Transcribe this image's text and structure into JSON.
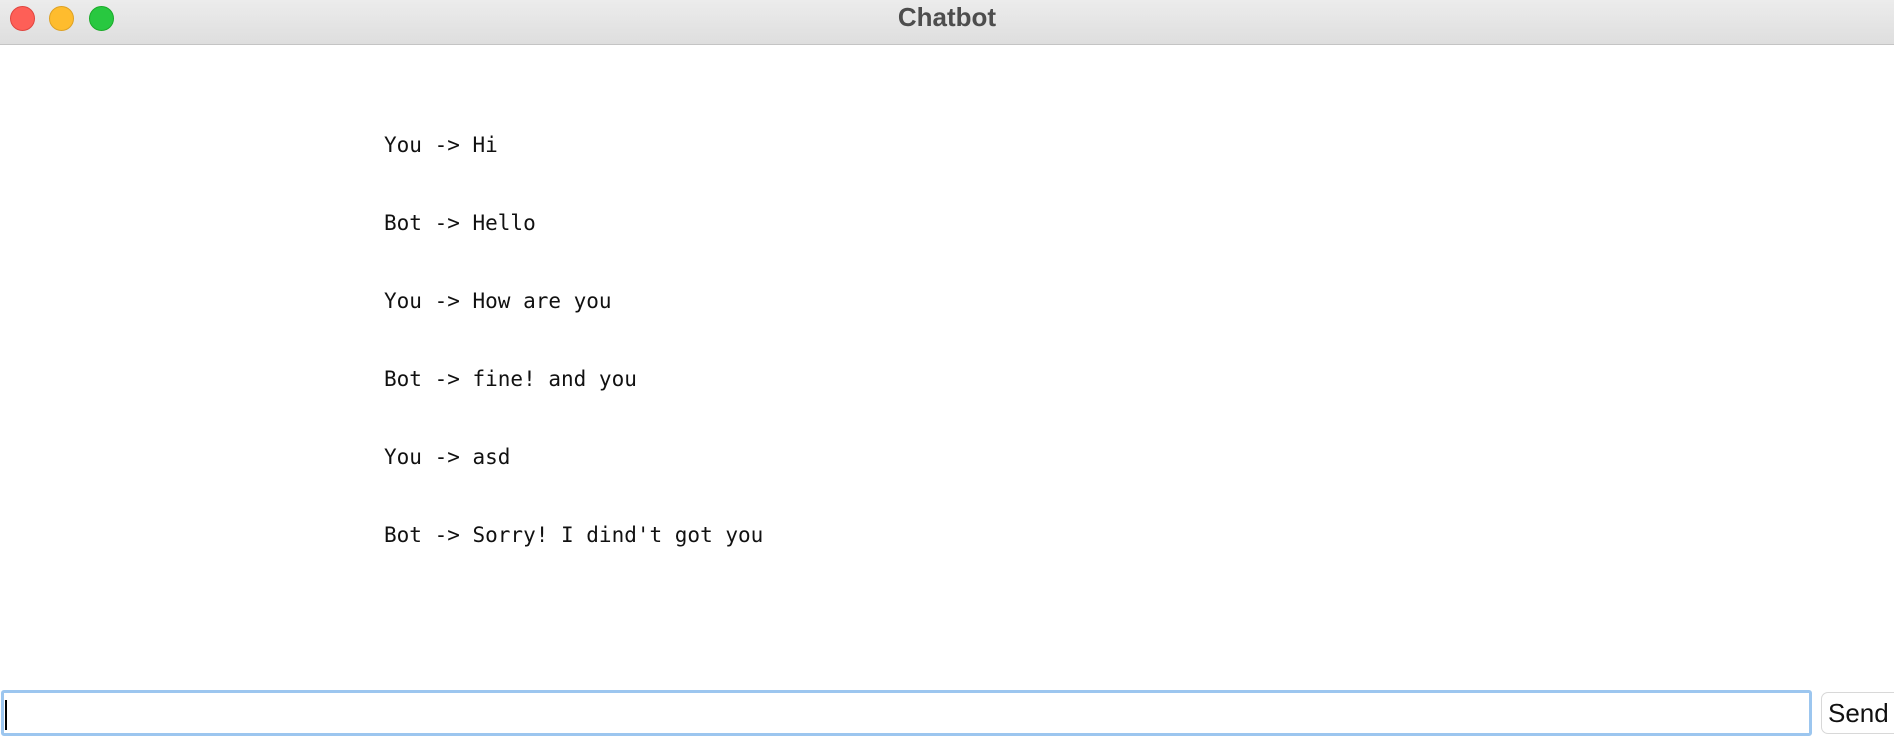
{
  "window": {
    "title": "Chatbot"
  },
  "transcript": {
    "lines": [
      "You -> Hi",
      "Bot -> Hello",
      "You -> How are you",
      "Bot -> fine! and you",
      "You -> asd",
      "Bot -> Sorry! I dind't got you"
    ]
  },
  "composer": {
    "value": "",
    "send_label": "Send"
  },
  "colors": {
    "close": "#fe5f57",
    "minimize": "#febc2e",
    "zoom": "#28c840",
    "input_focus_ring": "#9cc6ef"
  }
}
